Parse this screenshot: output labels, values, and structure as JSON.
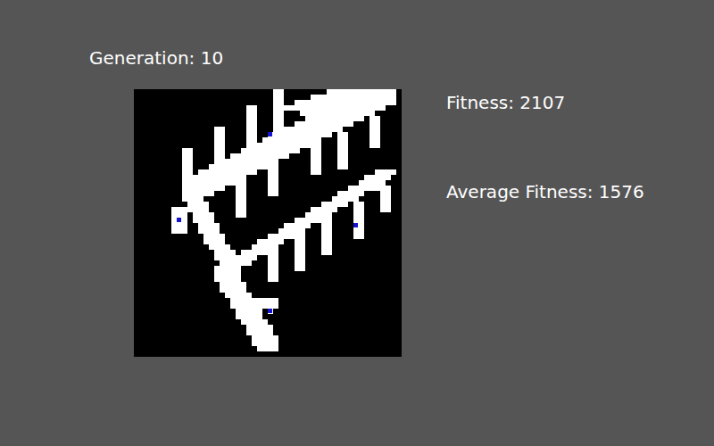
{
  "header": {
    "generation": "Generation: 10"
  },
  "stats": {
    "fitness": "Fitness: 2107",
    "average_fitness": "Average Fitness: 1576"
  },
  "grid": {
    "rows": [
      "..........................##........#############.",
      "..........................##.....################.",
      "..........................##..###################.",
      ".....................##...#####################...",
      ".....................##...##...##############.....",
      ".....................##...##....###########.##....",
      ".....................##...##..###########...##....",
      "...............##....##...#############.....##....",
      "...............##....##..o###########.##....##....",
      "...............##....##.###########...##....##....",
      "...............##....##############...##....##....",
      ".........##....##...###########..##...##..........",
      ".........##....##.###########....##...##..........",
      ".........##....############......##...##..........",
      ".........##...#############......##...##..........",
      ".........##.###########..##......##..........####.",
      ".........############....##................#####..",
      ".........############....##...............#####...",
      ".........########..##....##.............########..",
      ".........######....##....##...........#####...##..",
      ".........####......##................#####....##..",
      "..........####.....##..............#####.##...##..",
      ".......#######.....##............#####...##...##..",
      ".......###.####....##...........#####....##.......",
      ".......#o#.####...............#######....##.......",
      ".......###..####............#####..##....o#.......",
      ".......###..####...........#####...##....##.......",
      ".............####........#######...##....##.......",
      ".............####......#####..##...##.............",
      "..............####....#####...##...##.............",
      "...............####.#######...##...##.............",
      "...............########..##...##..................",
      "................######...##...##..................",
      "...............#####.....##...##..................",
      "...............#####.....##.......................",
      "...............#####.....##.......................",
      "................#####.............................",
      "................#####.............................",
      ".................#####............................",
      "..................#########.......................",
      "..................#########.......................",
      "...................#####.o........................",
      "...................#####..........................",
      "....................#####.........................",
      ".....................#####........................",
      ".....................#####........................",
      "......................#####.......................",
      "......................#####.......................",
      ".......................####.......................",
      ".................................................."
    ]
  }
}
